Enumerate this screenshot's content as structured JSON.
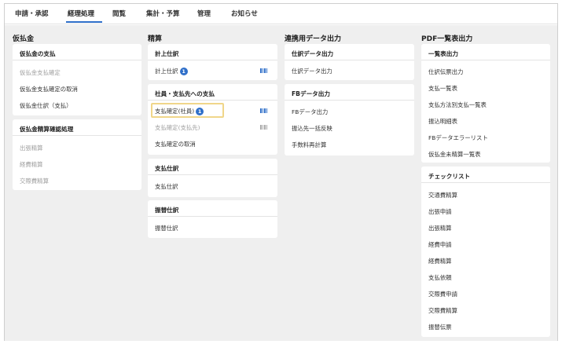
{
  "tabs": [
    {
      "label": "申請・承認"
    },
    {
      "label": "経理処理"
    },
    {
      "label": "閲覧"
    },
    {
      "label": "集計・予算"
    },
    {
      "label": "管理"
    },
    {
      "label": "お知らせ"
    }
  ],
  "active_tab": "経理処理",
  "accent_color": "#2f6fc9",
  "columns": {
    "karibarai": {
      "title": "仮払金",
      "card1": {
        "header": "仮払金の支払",
        "items": [
          "仮払金支払確定",
          "仮払金支払確定の取消",
          "仮払金仕訳（支払）"
        ]
      },
      "card2": {
        "header": "仮払金精算確認処理",
        "items": [
          "出張精算",
          "経費精算",
          "交際費精算"
        ]
      }
    },
    "seisan": {
      "title": "精算",
      "card1": {
        "header": "計上仕訳",
        "items": [
          "計上仕訳"
        ],
        "badge": "1"
      },
      "card2": {
        "header": "社員・支払先への支払",
        "items": [
          "支払確定(社員)",
          "支払確定(支払先)",
          "支払確定の取消"
        ],
        "badge": "1"
      },
      "card3": {
        "header": "支払仕訳",
        "items": [
          "支払仕訳"
        ]
      },
      "card4": {
        "header": "振替仕訳",
        "items": [
          "振替仕訳"
        ]
      }
    },
    "renkei": {
      "title": "連携用データ出力",
      "card1": {
        "header": "仕訳データ出力",
        "items": [
          "仕訳データ出力"
        ]
      },
      "card2": {
        "header": "FBデータ出力",
        "items": [
          "FBデータ出力",
          "振込先一括反映",
          "手数料再計算"
        ]
      }
    },
    "pdf": {
      "title": "PDF一覧表出力",
      "card1": {
        "header": "一覧表出力",
        "items": [
          "仕訳伝票出力",
          "支払一覧表",
          "支払方法別支払一覧表",
          "振込明細表",
          "FBデータエラーリスト",
          "仮払金未精算一覧表"
        ]
      },
      "card2": {
        "header": "チェックリスト",
        "items": [
          "交通費精算",
          "出張申請",
          "出張精算",
          "経費申請",
          "経費精算",
          "支払依頼",
          "交際費申請",
          "交際費精算",
          "振替伝票"
        ]
      }
    }
  }
}
